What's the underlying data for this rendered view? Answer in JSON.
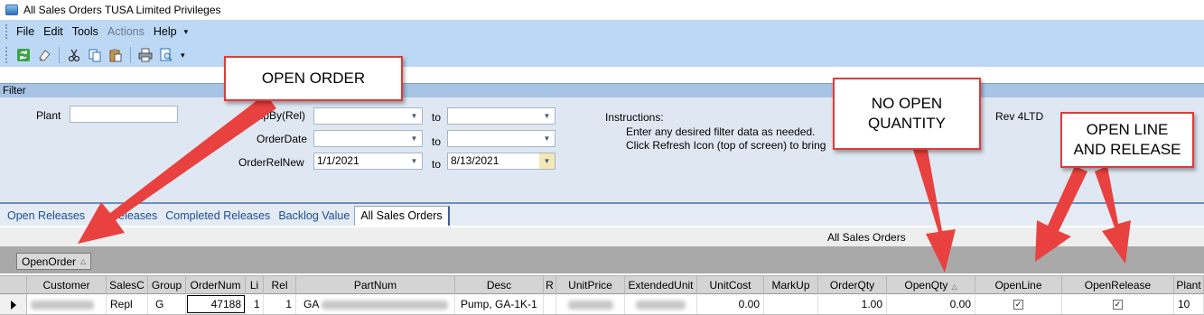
{
  "window": {
    "title": "All Sales Orders TUSA Limited Privileges"
  },
  "menu": [
    {
      "label": "File",
      "enabled": true
    },
    {
      "label": "Edit",
      "enabled": true
    },
    {
      "label": "Tools",
      "enabled": true
    },
    {
      "label": "Actions",
      "enabled": false
    },
    {
      "label": "Help",
      "enabled": true
    }
  ],
  "toolbar": {
    "icons": [
      "refresh-icon",
      "eraser-icon",
      "cut-icon",
      "copy-icon",
      "paste-icon",
      "print-icon",
      "print-preview-icon"
    ]
  },
  "filter": {
    "header": "Filter",
    "plant_label": "Plant",
    "plant_value": "",
    "shipby_label": "ShipBy(Rel)",
    "shipby_from": "",
    "shipby_to": "",
    "orderdate_label": "OrderDate",
    "orderdate_from": "",
    "orderdate_to": "",
    "orderrelnew_label": "OrderRelNew",
    "orderrelnew_from": "1/1/2021",
    "orderrelnew_to": "8/13/2021",
    "to_label": "to",
    "instructions_title": "Instructions:",
    "instructions_line1": "Enter any desired filter data as needed.",
    "instructions_line2": "Click Refresh Icon (top of screen) to bring",
    "rev": "Rev 4LTD"
  },
  "tabs": [
    {
      "label": "Open Releases",
      "active": false
    },
    {
      "label": "eleases",
      "active": false
    },
    {
      "label": "Completed Releases",
      "active": false
    },
    {
      "label": "Backlog Value",
      "active": false
    },
    {
      "label": "All Sales Orders",
      "active": true
    }
  ],
  "grid": {
    "title": "All Sales Orders",
    "group_by": "OpenOrder",
    "columns": [
      "Customer",
      "SalesC",
      "Group",
      "OrderNum",
      "Li",
      "Rel",
      "PartNum",
      "Desc",
      "R",
      "UnitPrice",
      "ExtendedUnit",
      "UnitCost",
      "MarkUp",
      "OrderQty",
      "OpenQty",
      "OpenLine",
      "OpenRelease",
      "Plant"
    ],
    "row": {
      "salesc": "Repl",
      "group": "G",
      "ordernum": "47188",
      "line": "1",
      "rel": "1",
      "partnum_prefix": "GA",
      "desc": "Pump, GA-1K-1",
      "unitcost": "0.00",
      "orderqty": "1.00",
      "openqty": "0.00",
      "openline": true,
      "openrelease": true,
      "plant": "10"
    }
  },
  "annotations": {
    "open_order": "OPEN ORDER",
    "no_open_qty_line1": "NO OPEN",
    "no_open_qty_line2": "QUANTITY",
    "open_line_line1": "OPEN LINE",
    "open_line_line2": "AND RELEASE"
  },
  "colors": {
    "menubar_bg": "#bcd8f5",
    "filter_bg": "#dfe8f2",
    "callout_border": "#e23a3a",
    "arrow": "#e8413f"
  }
}
